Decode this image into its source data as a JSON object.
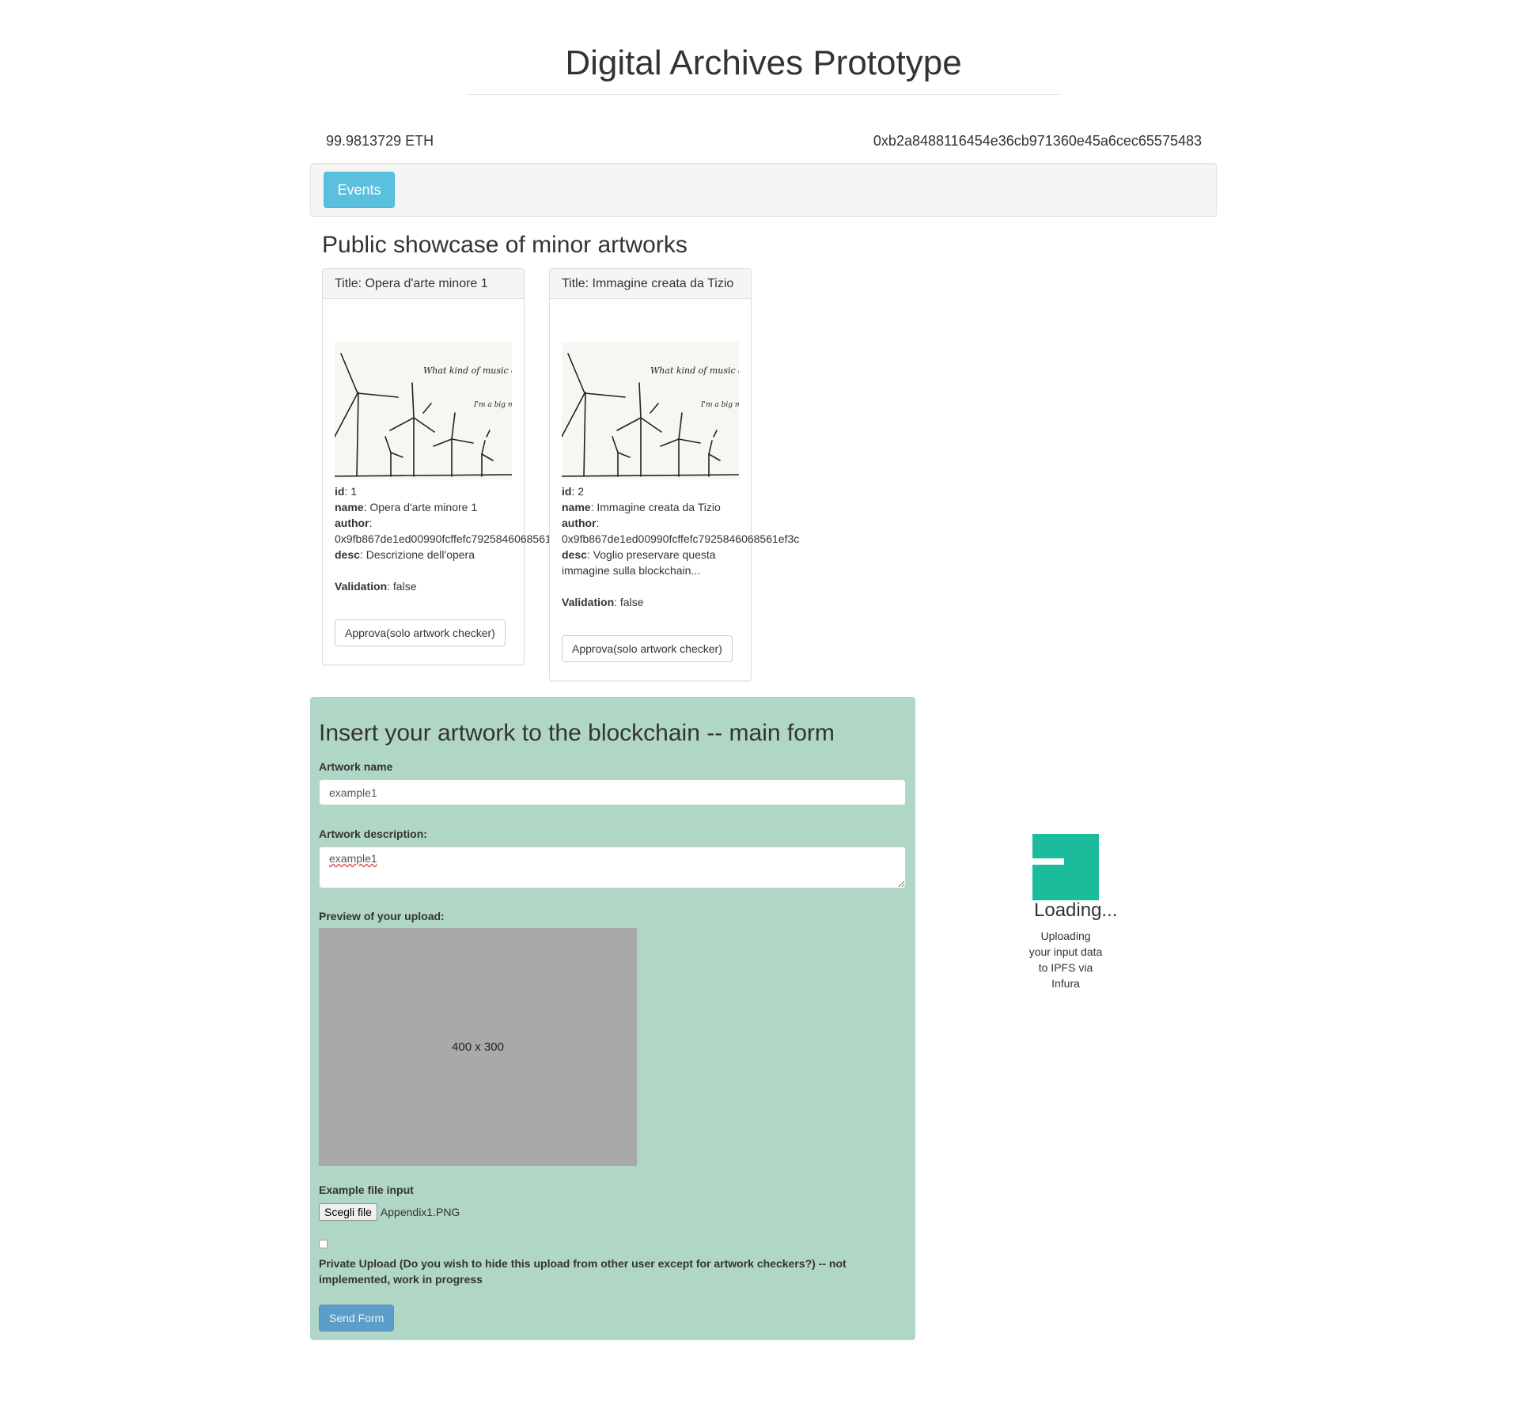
{
  "header": {
    "title": "Digital Archives Prototype",
    "balance": "99.9813729 ETH",
    "account": "0xb2a8488116454e36cb971360e45a6cec65575483"
  },
  "nav": {
    "events_label": "Events"
  },
  "showcase": {
    "title": "Public showcase of minor artworks",
    "cards": [
      {
        "header": "Title: Opera d'arte minore 1",
        "id_label": "id",
        "id": "1",
        "name_label": "name",
        "name": "Opera d'arte minore 1",
        "author_label": "author",
        "author": "0x9fb867de1ed00990fcffefc7925846068561",
        "desc_label": "desc",
        "desc": "Descrizione dell'opera",
        "validation_label": "Validation",
        "validation": "false",
        "approve_label": "Approva(solo artwork checker)"
      },
      {
        "header": "Title: Immagine creata da Tizio",
        "id_label": "id",
        "id": "2",
        "name_label": "name",
        "name": "Immagine creata da Tizio",
        "author_label": "author",
        "author": "0x9fb867de1ed00990fcffefc7925846068561ef3c",
        "desc_label": "desc",
        "desc": "Voglio preservare questa immagine sulla blockchain...",
        "validation_label": "Validation",
        "validation": "false",
        "approve_label": "Approva(solo artwork checker)"
      }
    ],
    "image_text": {
      "speech_1": "What kind of music do you like?",
      "speech_2": "I'm a big metal fan"
    }
  },
  "form": {
    "title": "Insert your artwork to the blockchain -- main form",
    "name_label": "Artwork name",
    "name_value": "example1",
    "desc_label": "Artwork description:",
    "desc_value": "example1",
    "preview_label": "Preview of your upload:",
    "preview_placeholder": "400 x 300",
    "file_label": "Example file input",
    "file_button": "Scegli file",
    "file_name": "Appendix1.PNG",
    "private_checked": false,
    "private_label": "Private Upload (Do you wish to hide this upload from other user except for artwork checkers?) -- not implemented, work in progress",
    "submit_label": "Send Form"
  },
  "loading": {
    "title": "Loading...",
    "message": "Uploading your input data to IPFS via Infura"
  },
  "colors": {
    "events_button": "#5bc0de",
    "form_background": "#b0d6c6",
    "loader": "#1abc9c",
    "send_button": "#428bca",
    "preview_placeholder": "#a9a9a9"
  }
}
